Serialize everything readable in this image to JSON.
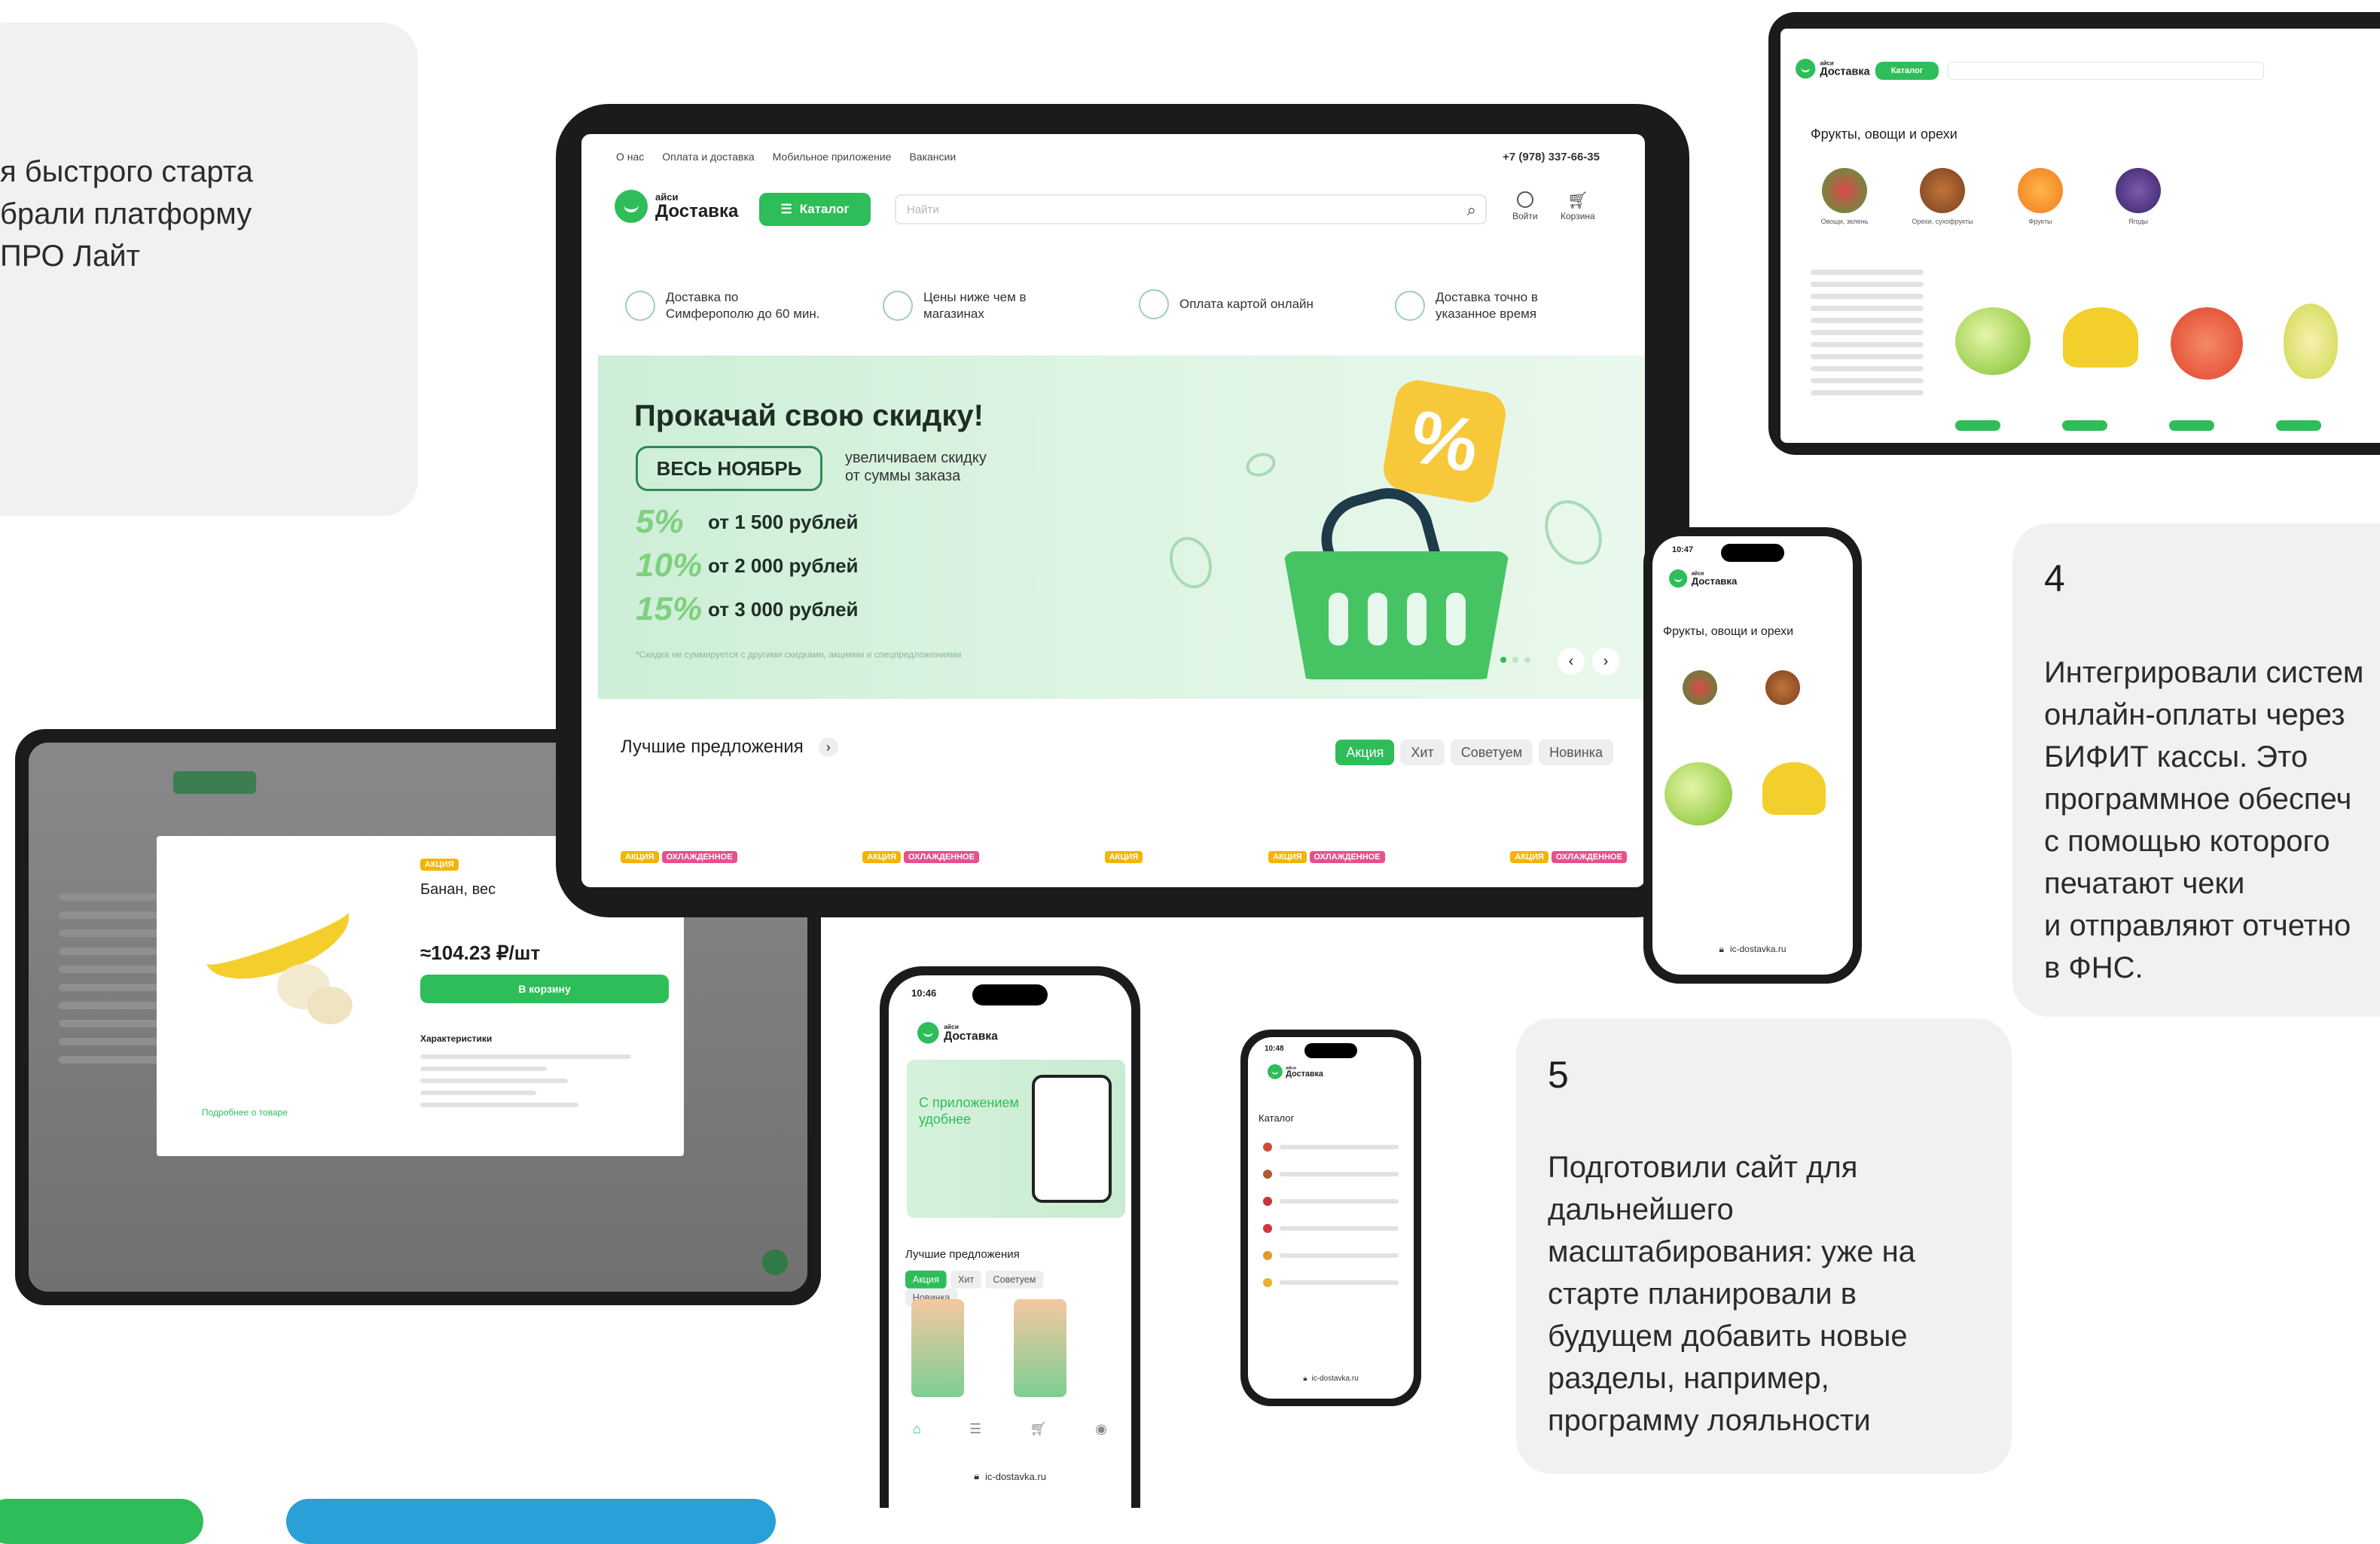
{
  "cards": {
    "card1": {
      "text": "я быстрого старта\nбрали платформу\nПРО Лайт"
    },
    "card4": {
      "number": "4",
      "text": "Интегрировали систем\nонлайн-оплаты через\nБИФИТ кассы. Это\nпрограммное обеспеч\nс помощью которого\nпечатают чеки\nи отправляют отчетно\nв ФНС."
    },
    "card5": {
      "number": "5",
      "text": "Подготовили сайт для\nдальнейшего\nмасштабирования: уже на\nстарте планировали в\nбудущем добавить новые\nразделы, например,\nпрограмму лояльности"
    }
  },
  "tablet_main": {
    "topnav": [
      "О нас",
      "Оплата и доставка",
      "Мобильное приложение",
      "Вакансии"
    ],
    "phone": "+7 (978) 337-66-35",
    "logo_small": "айси",
    "logo_big": "Доставка",
    "catalog_button": "Каталог",
    "search_placeholder": "Найти",
    "login_label": "Войти",
    "cart_label": "Корзина",
    "features": [
      "Доставка по\nСимферополю до 60 мин.",
      "Цены ниже чем в\nмагазинах",
      "Оплата картой онлайн",
      "Доставка точно в\nуказанное время"
    ],
    "banner": {
      "title": "Прокачай свою скидку!",
      "badge": "ВЕСЬ НОЯБРЬ",
      "badge_note": "увеличиваем скидку\nот суммы заказа",
      "discounts": [
        {
          "pct": "5%",
          "text": "от 1 500 рублей"
        },
        {
          "pct": "10%",
          "text": "от 2 000 рублей"
        },
        {
          "pct": "15%",
          "text": "от 3 000 рублей"
        }
      ],
      "footnote": "*Скидка не суммируется с другими скидками, акциями и спецпредложениями",
      "percent_symbol": "%"
    },
    "best_offers": "Лучшие предложения",
    "filter_chips": [
      "Акция",
      "Хит",
      "Советуем",
      "Новинка"
    ],
    "tags": [
      "АКЦИЯ",
      "ОХЛАЖДЕННОЕ"
    ]
  },
  "tablet_right": {
    "title": "Фрукты, овощи и орехи",
    "catalog_button": "Каталог",
    "categories": [
      "Овощи, зелень",
      "Орехи, сухофрукты",
      "Фрукты",
      "Ягоды"
    ]
  },
  "tablet_left": {
    "modal_tag": "АКЦИЯ",
    "modal_title": "Банан, вес",
    "modal_price": "≈104.23 ₽/шт",
    "modal_button": "В корзину",
    "modal_section": "Характеристики",
    "modal_link": "Подробнее о товаре"
  },
  "phone_a": {
    "time": "10:47",
    "title": "Фрукты, овощи и орехи",
    "url": "ic-dostavka.ru"
  },
  "phone_b": {
    "time": "10:46",
    "promo_title": "С приложением\nудобнее",
    "best_offers": "Лучшие предложения",
    "chips": [
      "Акция",
      "Хит",
      "Советуем",
      "Новинка"
    ],
    "url": "ic-dostavka.ru"
  },
  "phone_c": {
    "time": "10:48",
    "title": "Каталог",
    "url": "ic-dostavka.ru"
  },
  "colors": {
    "brand_green": "#2ebd59",
    "banner_bg": "#d6f1dc",
    "card_bg": "#f1f1f1"
  }
}
